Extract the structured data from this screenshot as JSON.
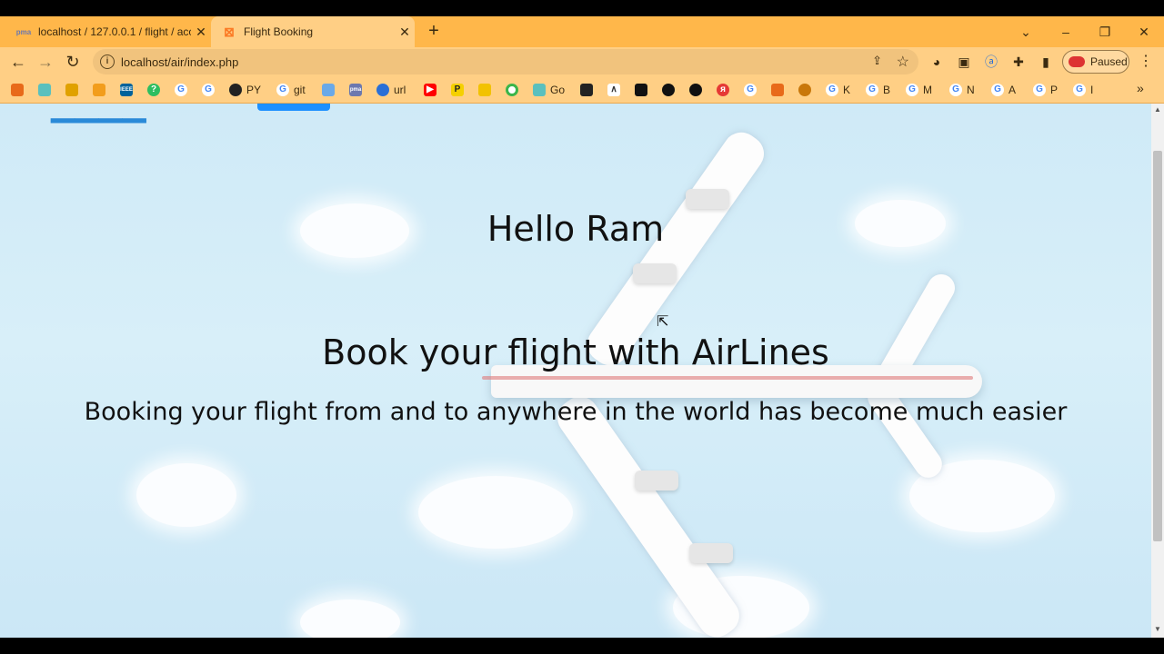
{
  "browser": {
    "tabs": [
      {
        "title": "localhost / 127.0.0.1 / flight / acc",
        "favicon": "phpmyadmin-icon",
        "active": false
      },
      {
        "title": "Flight Booking",
        "favicon": "xampp-icon",
        "active": true
      }
    ],
    "url": "localhost/air/index.php",
    "profile_status": "Paused",
    "bookmarks": [
      {
        "label": "",
        "icon": "bookmark-icon"
      },
      {
        "label": "",
        "icon": "bookmark-icon"
      },
      {
        "label": "",
        "icon": "bookmark-icon"
      },
      {
        "label": "",
        "icon": "bookmark-icon"
      },
      {
        "label": "",
        "icon": "ieee-icon"
      },
      {
        "label": "",
        "icon": "bookmark-icon"
      },
      {
        "label": "",
        "icon": "google-icon"
      },
      {
        "label": "",
        "icon": "google-icon"
      },
      {
        "label": "PY",
        "icon": "github-icon"
      },
      {
        "label": "git",
        "icon": "google-icon"
      },
      {
        "label": "",
        "icon": "bookmark-icon"
      },
      {
        "label": "",
        "icon": "bookmark-icon"
      },
      {
        "label": "url",
        "icon": "bookmark-icon"
      },
      {
        "label": "",
        "icon": "youtube-icon"
      },
      {
        "label": "",
        "icon": "bookmark-icon"
      },
      {
        "label": "",
        "icon": "bookmark-icon"
      },
      {
        "label": "",
        "icon": "bookmark-icon"
      },
      {
        "label": "Go",
        "icon": "bookmark-icon"
      },
      {
        "label": "",
        "icon": "bookmark-icon"
      },
      {
        "label": "",
        "icon": "bookmark-icon"
      },
      {
        "label": "",
        "icon": "bookmark-icon"
      },
      {
        "label": "",
        "icon": "bookmark-icon"
      },
      {
        "label": "",
        "icon": "bookmark-icon"
      },
      {
        "label": "",
        "icon": "bookmark-icon"
      },
      {
        "label": "",
        "icon": "google-icon"
      },
      {
        "label": "",
        "icon": "bookmark-icon"
      },
      {
        "label": "",
        "icon": "bookmark-icon"
      },
      {
        "label": "K",
        "icon": "google-icon"
      },
      {
        "label": "B",
        "icon": "google-icon"
      },
      {
        "label": "M",
        "icon": "google-icon"
      },
      {
        "label": "N",
        "icon": "google-icon"
      },
      {
        "label": "A",
        "icon": "google-icon"
      },
      {
        "label": "P",
        "icon": "google-icon"
      },
      {
        "label": "I",
        "icon": "google-icon"
      }
    ]
  },
  "page": {
    "greeting": "Hello Ram",
    "headline": "Book your flight with AirLines",
    "subline": "Booking your flight from and to anywhere in the world has become much easier"
  },
  "colors": {
    "chrome": "#ffb74a",
    "toolbar": "#ffcf85",
    "sky": "#d8eff9",
    "nav_button": "#1e90ff"
  }
}
